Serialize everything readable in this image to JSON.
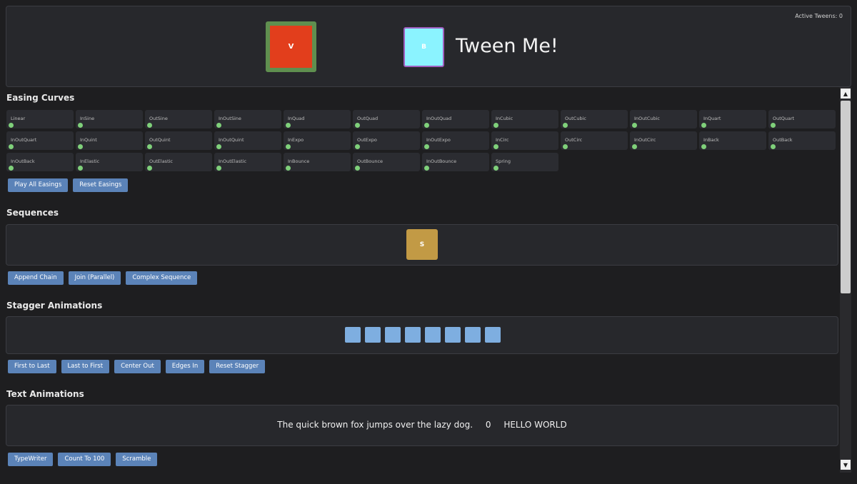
{
  "header": {
    "active_tweens": "Active Tweens: 0",
    "box_v_label": "V",
    "box_b_label": "B",
    "title": "Tween Me!"
  },
  "easing": {
    "title": "Easing Curves",
    "items": [
      "Linear",
      "InSine",
      "OutSine",
      "InOutSine",
      "InQuad",
      "OutQuad",
      "InOutQuad",
      "InCubic",
      "OutCubic",
      "InOutCubic",
      "InQuart",
      "OutQuart",
      "InOutQuart",
      "InQuint",
      "OutQuint",
      "InOutQuint",
      "InExpo",
      "OutExpo",
      "InOutExpo",
      "InCirc",
      "OutCirc",
      "InOutCirc",
      "InBack",
      "OutBack",
      "InOutBack",
      "InElastic",
      "OutElastic",
      "InOutElastic",
      "InBounce",
      "OutBounce",
      "InOutBounce",
      "Spring"
    ],
    "play_all": "Play All Easings",
    "reset": "Reset Easings"
  },
  "sequences": {
    "title": "Sequences",
    "box_label": "S",
    "append": "Append Chain",
    "join": "Join (Parallel)",
    "complex": "Complex Sequence"
  },
  "stagger": {
    "title": "Stagger Animations",
    "first_to_last": "First to Last",
    "last_to_first": "Last to First",
    "center_out": "Center Out",
    "edges_in": "Edges In",
    "reset": "Reset Stagger"
  },
  "text_anim": {
    "title": "Text Animations",
    "sentence": "The quick brown fox jumps over the lazy dog.",
    "counter": "0",
    "scramble_text": "HELLO WORLD",
    "typewriter": "TypeWriter",
    "count": "Count To 100",
    "scramble": "Scramble"
  },
  "colors": {
    "accent": "#5b83b8",
    "box_v": "#e23e1c",
    "box_b": "#8bf3ff",
    "box_s": "#c29a45",
    "stagger": "#7eaee0",
    "dot": "#7fd07a"
  }
}
